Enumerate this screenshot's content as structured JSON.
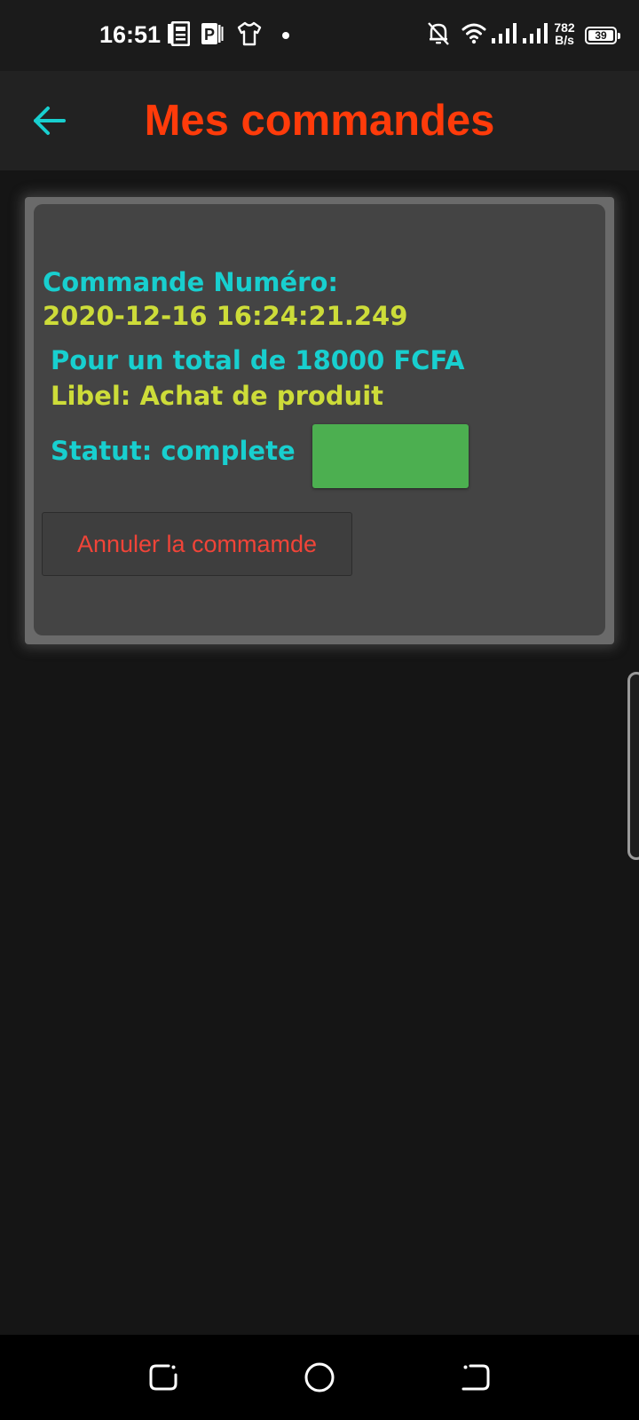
{
  "status_bar": {
    "time": "16:51",
    "notification_icons": [
      "news-icon",
      "parking-app-icon",
      "tshirt-icon"
    ],
    "net_speed_value": "782",
    "net_speed_unit": "B/s",
    "battery_level": "39",
    "system_icons": [
      "bell-off-icon",
      "wifi-icon",
      "signal-icon",
      "signal-icon",
      "battery-icon"
    ]
  },
  "app_bar": {
    "title": "Mes commandes",
    "back_icon": "arrow-left-icon"
  },
  "order": {
    "number_label": "Commande Numéro:",
    "number_value": "2020-12-16 16:24:21.249",
    "total_line": "Pour un total de 18000 FCFA",
    "label_line": "Libel: Achat de produit",
    "status_line": "Statut: complete",
    "status_color": "#4caf50",
    "cancel_button": "Annuler la commamde"
  },
  "colors": {
    "accent_title": "#ff3b0a",
    "accent_cyan": "#18cfcf",
    "accent_yellow": "#cddc39",
    "cancel_text": "#f04438"
  },
  "nav_bar": {
    "icons": [
      "recent-apps-icon",
      "home-icon",
      "back-gesture-icon"
    ]
  }
}
